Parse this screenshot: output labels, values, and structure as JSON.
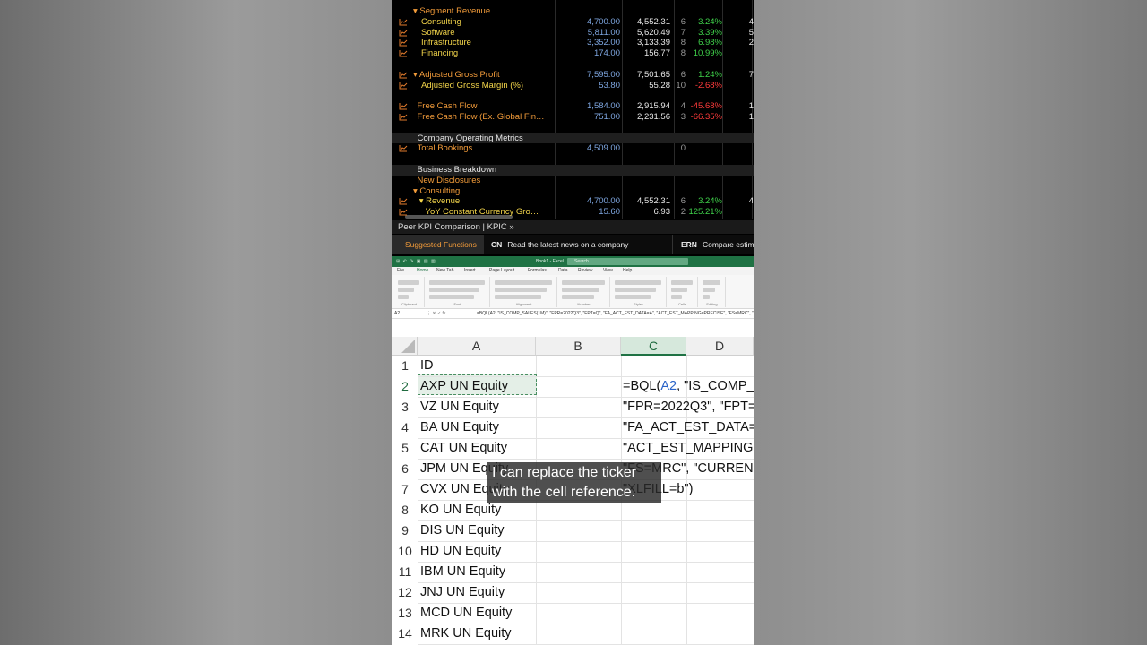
{
  "bloomberg": {
    "rows": [
      {
        "label": "▾ Segment Revenue",
        "color": "orange",
        "indent": 0,
        "icon": false,
        "v1": "",
        "v2": "",
        "n": "",
        "pct": "",
        "pctcolor": "green",
        "trail": ""
      },
      {
        "label": "Consulting",
        "color": "yellow",
        "indent": 2,
        "icon": true,
        "v1": "4,700.00",
        "v2": "4,552.31",
        "n": "6",
        "pct": "3.24%",
        "pctcolor": "green",
        "trail": "4"
      },
      {
        "label": "Software",
        "color": "yellow",
        "indent": 2,
        "icon": true,
        "v1": "5,811.00",
        "v2": "5,620.49",
        "n": "7",
        "pct": "3.39%",
        "pctcolor": "green",
        "trail": "5"
      },
      {
        "label": "Infrastructure",
        "color": "yellow",
        "indent": 2,
        "icon": true,
        "v1": "3,352.00",
        "v2": "3,133.39",
        "n": "8",
        "pct": "6.98%",
        "pctcolor": "green",
        "trail": "2"
      },
      {
        "label": "Financing",
        "color": "yellow",
        "indent": 2,
        "icon": true,
        "v1": "174.00",
        "v2": "156.77",
        "n": "8",
        "pct": "10.99%",
        "pctcolor": "green",
        "trail": ""
      },
      {
        "label": "",
        "color": "white",
        "indent": 0,
        "icon": false,
        "v1": "",
        "v2": "",
        "n": "",
        "pct": "",
        "pctcolor": "green",
        "trail": ""
      },
      {
        "label": "▾ Adjusted Gross Profit",
        "color": "orange",
        "indent": 0,
        "icon": true,
        "v1": "7,595.00",
        "v2": "7,501.65",
        "n": "6",
        "pct": "1.24%",
        "pctcolor": "green",
        "trail": "7"
      },
      {
        "label": "Adjusted Gross Margin (%)",
        "color": "yellow",
        "indent": 2,
        "icon": true,
        "v1": "53.80",
        "v2": "55.28",
        "n": "10",
        "pct": "-2.68%",
        "pctcolor": "red",
        "trail": ""
      },
      {
        "label": "",
        "color": "white",
        "indent": 0,
        "icon": false,
        "v1": "",
        "v2": "",
        "n": "",
        "pct": "",
        "pctcolor": "green",
        "trail": ""
      },
      {
        "label": "Free Cash Flow",
        "color": "orange",
        "indent": 1,
        "icon": true,
        "v1": "1,584.00",
        "v2": "2,915.94",
        "n": "4",
        "pct": "-45.68%",
        "pctcolor": "red",
        "trail": "1"
      },
      {
        "label": "Free Cash Flow (Ex. Global Fin…",
        "color": "orange",
        "indent": 1,
        "icon": true,
        "v1": "751.00",
        "v2": "2,231.56",
        "n": "3",
        "pct": "-66.35%",
        "pctcolor": "red",
        "trail": "1"
      },
      {
        "label": "",
        "color": "white",
        "indent": 0,
        "icon": false,
        "v1": "",
        "v2": "",
        "n": "",
        "pct": "",
        "pctcolor": "green",
        "trail": ""
      },
      {
        "label": "Company Operating Metrics",
        "color": "white",
        "indent": 1,
        "icon": false,
        "shade": true,
        "v1": "",
        "v2": "",
        "n": "",
        "pct": "",
        "pctcolor": "green",
        "trail": ""
      },
      {
        "label": "Total Bookings",
        "color": "orange",
        "indent": 1,
        "icon": true,
        "v1": "4,509.00",
        "v2": "",
        "n": "0",
        "pct": "",
        "pctcolor": "green",
        "trail": ""
      },
      {
        "label": "",
        "color": "white",
        "indent": 0,
        "icon": false,
        "v1": "",
        "v2": "",
        "n": "",
        "pct": "",
        "pctcolor": "green",
        "trail": ""
      },
      {
        "label": "Business Breakdown",
        "color": "white",
        "indent": 1,
        "icon": false,
        "shade": true,
        "v1": "",
        "v2": "",
        "n": "",
        "pct": "",
        "pctcolor": "green",
        "trail": ""
      },
      {
        "label": "New Disclosures",
        "color": "orange",
        "indent": 1,
        "icon": false,
        "v1": "",
        "v2": "",
        "n": "",
        "pct": "",
        "pctcolor": "green",
        "trail": ""
      },
      {
        "label": "▾ Consulting",
        "color": "orange",
        "indent": 0,
        "icon": false,
        "v1": "",
        "v2": "",
        "n": "",
        "pct": "",
        "pctcolor": "green",
        "trail": ""
      },
      {
        "label": "▾ Revenue",
        "color": "yellow",
        "indent": 1.5,
        "icon": true,
        "v1": "4,700.00",
        "v2": "4,552.31",
        "n": "6",
        "pct": "3.24%",
        "pctcolor": "green",
        "trail": "4"
      },
      {
        "label": "YoY Constant Currency Gro…",
        "color": "yellow",
        "indent": 3,
        "icon": true,
        "v1": "15.60",
        "v2": "6.93",
        "n": "2",
        "pct": "125.21%",
        "pctcolor": "green",
        "trail": ""
      }
    ],
    "peer_bar": "Peer KPI Comparison | KPIC »",
    "suggested": "Suggested Functions",
    "cn_code": "CN",
    "cn_text": "Read the latest news on a company",
    "ern_code": "ERN",
    "ern_text": "Compare estim"
  },
  "excel": {
    "workbook": "Book1 - Excel",
    "search": "Search",
    "menu": [
      "File",
      "Home",
      "New Tab",
      "Insert",
      "Page Layout",
      "Formulas",
      "Data",
      "Review",
      "View",
      "Help"
    ],
    "ribbon_groups": [
      "Clipboard",
      "Font",
      "Alignment",
      "Number",
      "Styles",
      "Cells",
      "Editing"
    ],
    "name_box": "A2",
    "formula": "=BQL(A2, \"IS_COMP_SALES(1M)\", \"FPR=2022Q3\", \"FPT=Q\", \"FA_ACT_EST_DATA=A\", \"ACT_EST_MAPPING=PRECISE\", \"FS=MRC\", \"CURRENCY=USD\", \"XLFILL=b\")",
    "columns": [
      "A",
      "B",
      "C",
      "D"
    ],
    "rows": [
      "1",
      "2",
      "3",
      "4",
      "5",
      "6",
      "7",
      "8",
      "9",
      "10",
      "11",
      "12",
      "13",
      "14"
    ],
    "colA": [
      "ID",
      "AXP UN Equity",
      "VZ UN Equity",
      "BA UN Equity",
      "CAT UN Equity",
      "JPM UN Equity",
      "CVX UN Equity",
      "KO UN Equity",
      "DIS UN Equity",
      "HD UN Equity",
      "IBM UN Equity",
      "JNJ UN Equity",
      "MCD UN Equity",
      "MRK UN Equity"
    ],
    "colC": {
      "line1_pre": "=BQL(",
      "line1_ref": "A2",
      "line1_post": ", \"IS_COMP_",
      "line2": "\"FPR=2022Q3\", \"FPT=",
      "line3": "\"FA_ACT_EST_DATA=",
      "line4": "\"ACT_EST_MAPPING=",
      "line5": "\"FS=MRC\", \"CURRENC",
      "line6": "\"XLFILL=b\")"
    }
  },
  "caption": {
    "line1": "I can replace the ticker",
    "line2": "with the cell reference."
  }
}
